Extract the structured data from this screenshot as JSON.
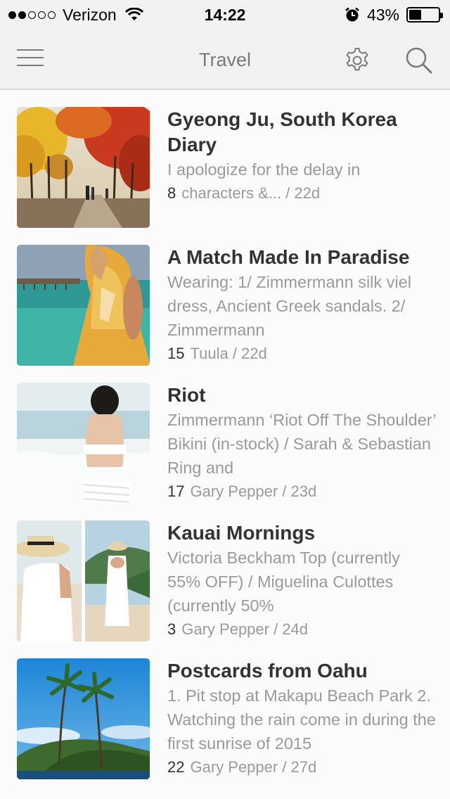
{
  "status": {
    "carrier": "Verizon",
    "time": "14:22",
    "battery": "43%",
    "battery_level": 0.43,
    "signal_bars": 2
  },
  "nav": {
    "title": "Travel"
  },
  "icons": {
    "menu": "hamburger-icon",
    "settings": "gear-icon",
    "search": "search-icon",
    "wifi": "wifi-icon",
    "alarm": "alarm-clock-icon"
  },
  "posts": [
    {
      "title": "Gyeong Ju, South Korea Diary",
      "excerpt": "I apologize for the delay in",
      "count": "8",
      "meta": "characters &... / 22d",
      "image": "autumn-trees-path"
    },
    {
      "title": "A Match Made In Paradise",
      "excerpt": "Wearing: 1/ Zimmermann silk viel dress, Ancient Greek sandals.  2/ Zimmermann",
      "count": "15",
      "meta": "Tuula / 22d",
      "image": "woman-yellow-dress-lagoon"
    },
    {
      "title": "Riot",
      "excerpt": "Zimmermann ‘Riot Off The Shoulder’ Bikini (in-stock) / Sarah & Sebastian Ring and",
      "count": "17",
      "meta": "Gary Pepper / 23d",
      "image": "woman-white-bikini-beach"
    },
    {
      "title": "Kauai Mornings",
      "excerpt": "Victoria Beckham Top (currently 55% OFF) / Miguelina Culottes (currently 50%",
      "count": "3",
      "meta": "Gary Pepper / 24d",
      "image": "woman-hat-white-outfit"
    },
    {
      "title": "Postcards from Oahu",
      "excerpt": "1. Pit stop at Makapu Beach Park 2. Watching the rain come in during the first sunrise of 2015",
      "count": "22",
      "meta": "Gary Pepper / 27d",
      "image": "palm-trees-island"
    }
  ]
}
